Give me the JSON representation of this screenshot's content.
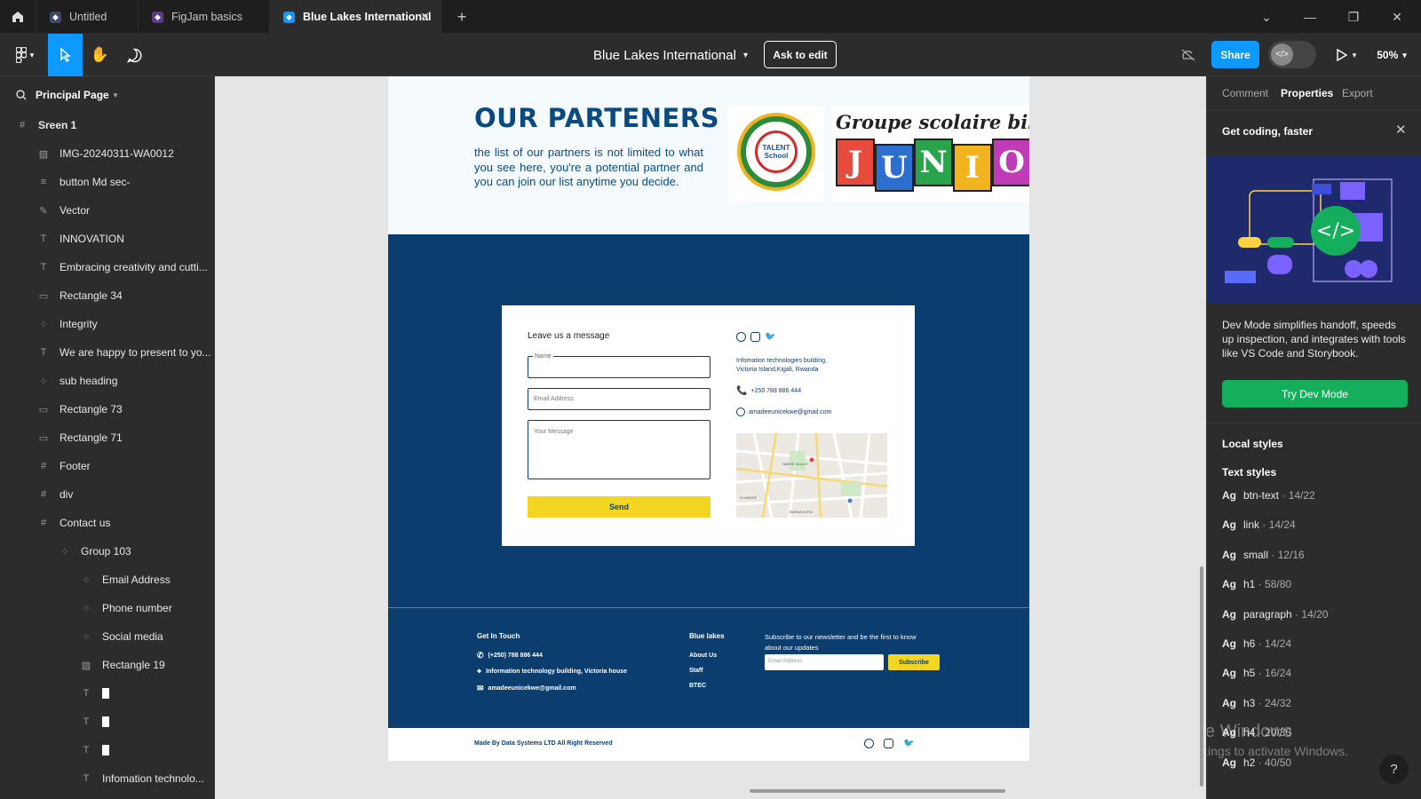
{
  "tabs": [
    {
      "label": "Untitled"
    },
    {
      "label": "FigJam basics"
    },
    {
      "label": "Blue Lakes International"
    }
  ],
  "toolbar": {
    "file_title": "Blue Lakes International",
    "ask_to_edit": "Ask to edit",
    "share": "Share",
    "zoom": "50%"
  },
  "left_panel": {
    "page_name": "Principal Page",
    "layers": [
      {
        "label": "Sreen 1",
        "icon": "frame-icon",
        "indent": 0,
        "bold": true
      },
      {
        "label": "IMG-20240311-WA0012",
        "icon": "image-icon",
        "indent": 1
      },
      {
        "label": "button Md sec-",
        "icon": "text-lines-icon",
        "indent": 1
      },
      {
        "label": "Vector",
        "icon": "vector-icon",
        "indent": 1
      },
      {
        "label": "INNOVATION",
        "icon": "text-icon",
        "indent": 1
      },
      {
        "label": "Embracing creativity and cutti...",
        "icon": "text-icon",
        "indent": 1
      },
      {
        "label": "Rectangle 34",
        "icon": "rectangle-icon",
        "indent": 1
      },
      {
        "label": "Integrity",
        "icon": "group-icon",
        "indent": 1
      },
      {
        "label": "We are happy to present to yo...",
        "icon": "text-icon",
        "indent": 1
      },
      {
        "label": "sub heading",
        "icon": "group-icon",
        "indent": 1
      },
      {
        "label": "Rectangle 73",
        "icon": "rectangle-icon",
        "indent": 1
      },
      {
        "label": "Rectangle 71",
        "icon": "rectangle-icon",
        "indent": 1
      },
      {
        "label": "Footer",
        "icon": "frame-icon",
        "indent": 1
      },
      {
        "label": "div",
        "icon": "frame-icon",
        "indent": 1
      },
      {
        "label": "Contact us",
        "icon": "frame-icon",
        "indent": 1
      },
      {
        "label": "Group 103",
        "icon": "group-icon",
        "indent": 2
      },
      {
        "label": "Email Address",
        "icon": "group-icon",
        "indent": 3
      },
      {
        "label": "Phone number",
        "icon": "group-icon",
        "indent": 3
      },
      {
        "label": "Social media",
        "icon": "group-icon",
        "indent": 3
      },
      {
        "label": "Rectangle 19",
        "icon": "image-icon",
        "indent": 3
      },
      {
        "label": "",
        "icon": "text-icon",
        "indent": 3
      },
      {
        "label": "",
        "icon": "text-icon",
        "indent": 3
      },
      {
        "label": "",
        "icon": "text-icon",
        "indent": 3
      },
      {
        "label": "Infomation technolo...",
        "icon": "text-icon",
        "indent": 3
      }
    ]
  },
  "design": {
    "partners_title": "OUR PARTENERS",
    "partners_text": "the list of our partners is not limited to what you see here, you're a potential partner and you can join our list anytime you decide.",
    "partner_logo_text": "TALENT School",
    "partner2_title": "Groupe scolaire bilingue",
    "partner2_letters": [
      "J",
      "U",
      "N",
      "I",
      "O"
    ],
    "form": {
      "heading": "Leave us a message",
      "name_label": "Name",
      "email_placeholder": "Email Address",
      "message_placeholder": "Your Message",
      "send": "Send"
    },
    "contact": {
      "address": "Infomation technologies building, Victoria Island,Kigali, Rwanda",
      "phone": "+250 788 886 444",
      "email": "amadeeunicekwe@gmail.com"
    },
    "map_labels": [
      "NAKEE VALLEY",
      "N HAIGHT",
      "BUENA VISTA"
    ],
    "footer": {
      "get_in_touch": "Get In Touch",
      "phone": "(+250) 788 886 444",
      "address": "Information technology building, Victoria house",
      "email": "amadeeunicekwe@gmail.com",
      "blue_lakes": "Blue lakes",
      "links": [
        "About Us",
        "Staff",
        "BTEC"
      ],
      "newsletter_text": "Subscribe to our newsletter and be the first to know about our updates",
      "newsletter_placeholder": "Email Address",
      "subscribe": "Subscribe",
      "made_by": "Made By Data Systems LTD All Right Reserved"
    }
  },
  "right_panel": {
    "tabs": [
      "Comment",
      "Properties",
      "Export"
    ],
    "promo_title": "Get coding, faster",
    "promo_text": "Dev Mode simplifies handoff, speeds up inspection, and integrates with tools like VS Code and Storybook.",
    "try_dev_mode": "Try Dev Mode",
    "local_styles": "Local styles",
    "text_styles": "Text styles",
    "styles": [
      {
        "name": "btn-text",
        "spec": "14/22"
      },
      {
        "name": "link",
        "spec": "14/24"
      },
      {
        "name": "small",
        "spec": "12/16"
      },
      {
        "name": "h1",
        "spec": "58/80"
      },
      {
        "name": "paragraph",
        "spec": "14/20"
      },
      {
        "name": "h6",
        "spec": "14/24"
      },
      {
        "name": "h5",
        "spec": "16/24"
      },
      {
        "name": "h3",
        "spec": "24/32"
      },
      {
        "name": "h4",
        "spec": "20/30"
      },
      {
        "name": "h2",
        "spec": "40/50"
      }
    ],
    "watermark_title": "Activate Windows",
    "watermark_sub": "Go to Settings to activate Windows."
  },
  "colors": {
    "brand_blue": "#0b3e6f",
    "accent_yellow": "#f2d622",
    "share_blue": "#0d99ff",
    "dev_green": "#14ae5c",
    "partners_title_blue": "#0b4a7e"
  }
}
